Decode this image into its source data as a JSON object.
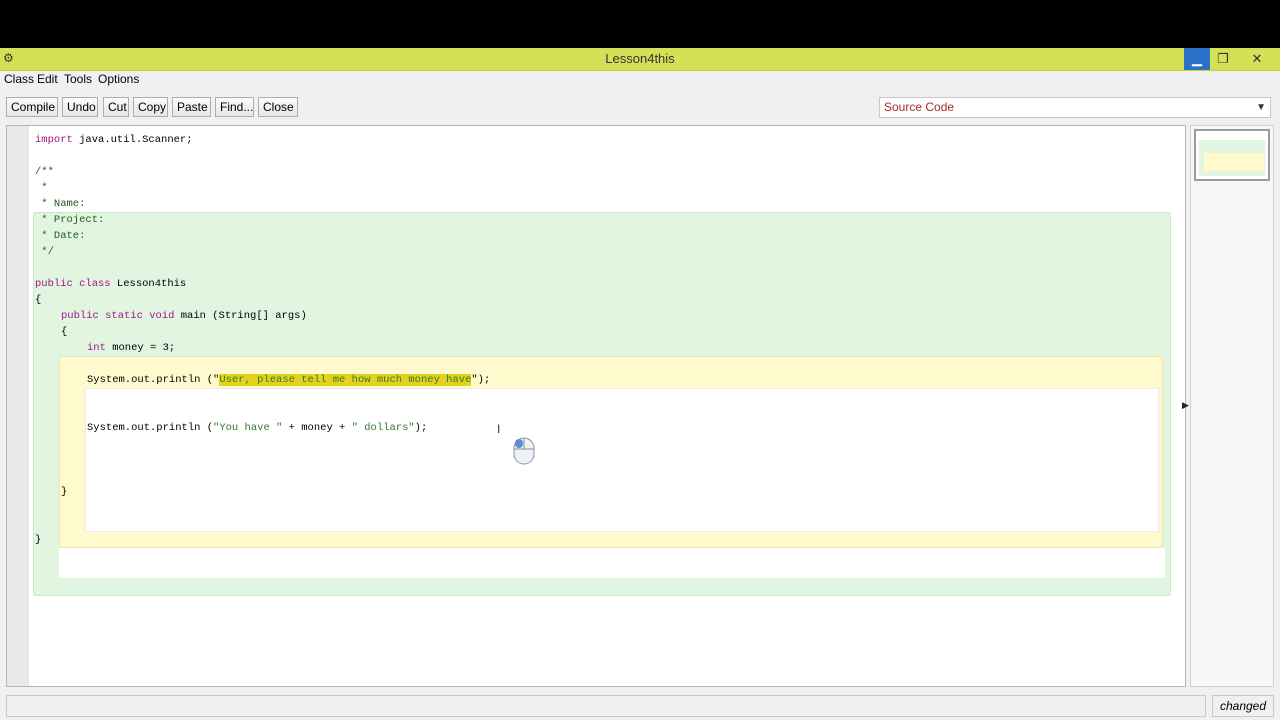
{
  "window": {
    "title": "Lesson4this"
  },
  "menu": [
    "Class",
    "Edit",
    "Tools",
    "Options"
  ],
  "toolbar": {
    "buttons": [
      "Compile",
      "Undo",
      "Cut",
      "Copy",
      "Paste",
      "Find...",
      "Close"
    ]
  },
  "view_selector": {
    "selected": "Source Code"
  },
  "code": {
    "import_kw": "import",
    "import_rest": " java.util.Scanner;",
    "comment": [
      "/**",
      " *",
      " * Name:",
      " * Project:",
      " * Date:",
      " */"
    ],
    "class_kw": "public class",
    "class_name": " Lesson4this",
    "open_brace": "{",
    "method_kw": "public static void",
    "method_rest": " main (String[] args)",
    "int_kw": "int",
    "int_rest": " money = 3;",
    "println1_pre": "System.out.println (\"",
    "println1_sel": "User, please tell me how much money have",
    "println1_post": "\");",
    "println2_pre": "System.out.println (",
    "println2_str1": "\"You have \"",
    "println2_mid": " + money + ",
    "println2_str2": "\" dollars\"",
    "println2_post": ");",
    "close_brace": "}"
  },
  "status": {
    "left": "",
    "right": "changed"
  },
  "colors": {
    "titlebar": "#d4e157",
    "class_scope": "#e1f5e1",
    "method_scope": "#fffacd",
    "keyword": "#a0148c",
    "selection": "#e6d21e"
  },
  "icons": [
    "app-icon",
    "minimize-icon",
    "maximize-icon",
    "close-icon",
    "chevron-down-icon",
    "text-cursor-icon",
    "mouse-icon",
    "expand-arrow-icon"
  ]
}
